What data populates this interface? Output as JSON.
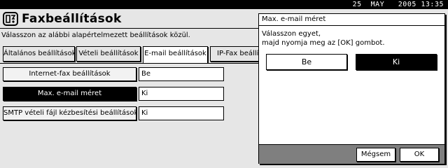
{
  "status_bar": {
    "datetime": "25  MAY   2005 13:35"
  },
  "header": {
    "title": "Faxbeállítások",
    "icon": "fax-settings-icon"
  },
  "instruction": "Válasszon az alábbi alapértelmezett beállítások közül.",
  "tabs": [
    {
      "label": "Általános beállítások",
      "active": false
    },
    {
      "label": "Vételi beállítások",
      "active": false
    },
    {
      "label": "E-mail beállítások",
      "active": true
    },
    {
      "label": "IP-Fax beállítások",
      "active": false
    }
  ],
  "settings": [
    {
      "label": "Internet-fax beállítások",
      "value": "Be",
      "selected": false
    },
    {
      "label": "Max. e-mail méret",
      "value": "Ki",
      "selected": true
    },
    {
      "label": "SMTP vételi fájl kézbesítési beállítások",
      "value": "Ki",
      "selected": false
    }
  ],
  "dialog": {
    "title": "Max. e-mail méret",
    "message_line1": "Válasszon egyet,",
    "message_line2": "majd nyomja meg az [OK] gombot.",
    "options": [
      {
        "label": "Be",
        "selected": false
      },
      {
        "label": "Ki",
        "selected": true
      }
    ],
    "cancel_label": "Mégsem",
    "ok_label": "OK"
  },
  "colors": {
    "background": "#e6e6e6",
    "selected": "#000000",
    "footer": "#7f7f7f"
  }
}
